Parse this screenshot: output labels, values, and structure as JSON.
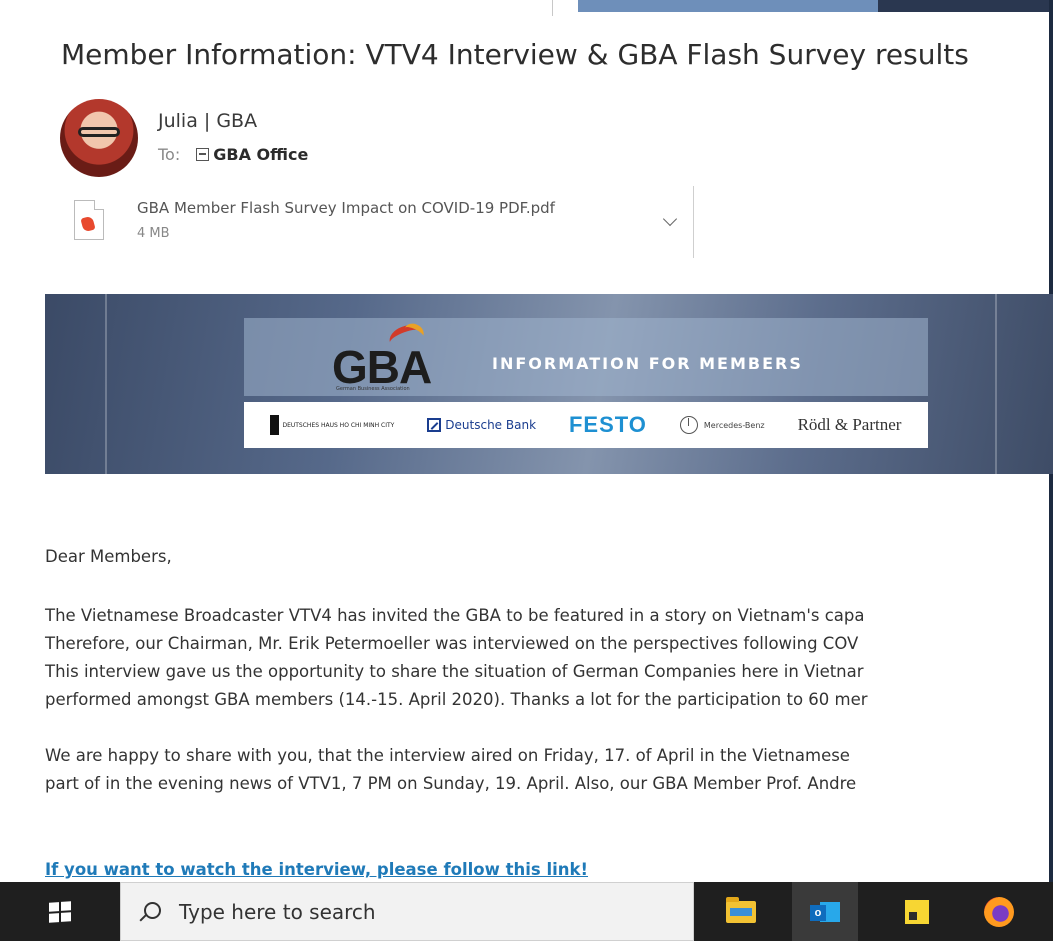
{
  "email": {
    "subject": "Member Information: VTV4 Interview & GBA Flash Survey results",
    "sender": "Julia | GBA",
    "to_label": "To:",
    "recipient": "GBA Office",
    "attachment": {
      "name": "GBA Member Flash Survey Impact on COVID-19 PDF.pdf",
      "size": "4 MB"
    }
  },
  "banner": {
    "logo_text": "GBA",
    "logo_tagline": "German Business Association",
    "title": "INFORMATION FOR MEMBERS",
    "sponsors": [
      "DEUTSCHES HAUS HO CHI MINH CITY",
      "Deutsche Bank",
      "FESTO",
      "Mercedes-Benz",
      "Rödl & Partner"
    ]
  },
  "body": {
    "greeting": "Dear Members,",
    "paragraph1": [
      "The Vietnamese Broadcaster VTV4 has invited the GBA to be featured in a story on Vietnam's capa",
      "Therefore, our Chairman, Mr. Erik Petermoeller was interviewed on the perspectives following COV",
      "This interview gave us the opportunity to share the situation of German Companies here in Vietnar",
      "performed amongst GBA members (14.-15. April 2020). Thanks a lot for the participation to 60 mer"
    ],
    "paragraph2": [
      "We are happy to share with you, that the interview aired on Friday, 17. of April in the Vietnamese",
      "part of in the evening news of VTV1, 7 PM on Sunday, 19. April. Also, our GBA Member Prof. Andre"
    ],
    "link": "If you want to watch the interview, please follow this link!"
  },
  "taskbar": {
    "search_placeholder": "Type here to search",
    "outlook_letter": "o",
    "icons": [
      "windows-logo",
      "search-icon",
      "file-explorer-icon",
      "outlook-icon",
      "sticky-notes-icon",
      "firefox-icon"
    ]
  },
  "colors": {
    "link": "#1f7ab8",
    "taskbar": "#1f1f1f",
    "banner_accent": "#56698a",
    "festo": "#1e90d2"
  }
}
